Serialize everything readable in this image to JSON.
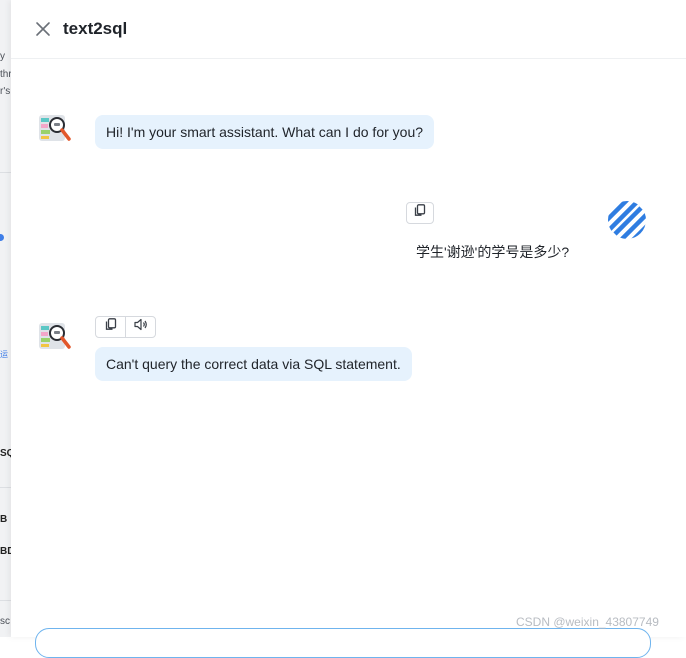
{
  "header": {
    "title": "text2sql",
    "close_icon": "close-icon"
  },
  "messages": {
    "greeting": "Hi! I'm your smart assistant. What can I do for you?",
    "user_question": "学生'谢逊'的学号是多少?",
    "bot_reply": "Can't query the correct data via SQL statement."
  },
  "tools": {
    "copy_icon": "copy-icon",
    "speaker_icon": "speaker-icon"
  },
  "background_fragments": {
    "f1": "y",
    "f2": "thr",
    "f3": "r's",
    "f4": "运",
    "f5": "SQ",
    "f6": "B",
    "f7": "BD",
    "f8": "sc"
  },
  "watermark": "CSDN @weixin_43807749",
  "colors": {
    "bot_bubble": "#e6f2fd",
    "input_border": "#6fb4ee",
    "user_avatar_blue": "#2f7de1"
  }
}
